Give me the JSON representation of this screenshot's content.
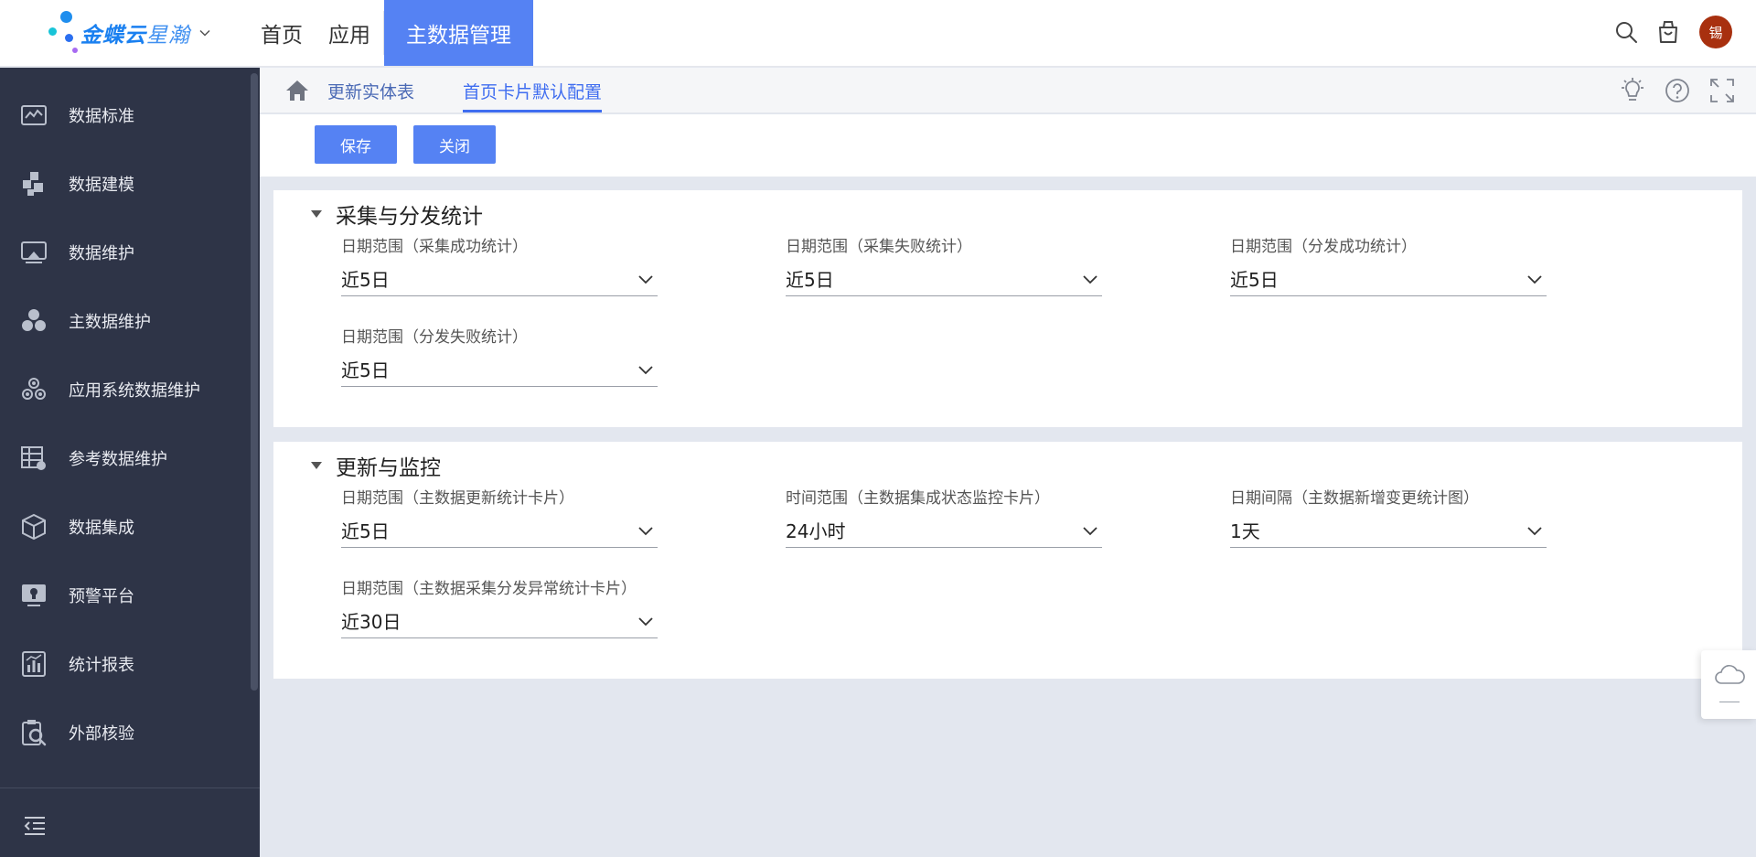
{
  "app": {
    "logo_text": "金蝶云",
    "logo_sub": "星瀚"
  },
  "topnav": {
    "items": [
      {
        "label": "首页"
      },
      {
        "label": "应用"
      },
      {
        "label": "主数据管理"
      }
    ],
    "active_index": 2,
    "avatar_text": "锡"
  },
  "sidebar": {
    "items": [
      {
        "label": "数据标准",
        "icon": "data-standard-icon"
      },
      {
        "label": "数据建模",
        "icon": "data-modeling-icon"
      },
      {
        "label": "数据维护",
        "icon": "data-maintenance-icon"
      },
      {
        "label": "主数据维护",
        "icon": "master-data-icon"
      },
      {
        "label": "应用系统数据维护",
        "icon": "app-system-data-icon"
      },
      {
        "label": "参考数据维护",
        "icon": "reference-data-icon"
      },
      {
        "label": "数据集成",
        "icon": "data-integration-icon"
      },
      {
        "label": "预警平台",
        "icon": "alert-platform-icon"
      },
      {
        "label": "统计报表",
        "icon": "statistics-report-icon"
      },
      {
        "label": "外部核验",
        "icon": "external-verify-icon"
      }
    ]
  },
  "tabs": [
    {
      "label": "更新实体表"
    },
    {
      "label": "首页卡片默认配置"
    }
  ],
  "active_tab": 1,
  "toolbar": {
    "save_label": "保存",
    "close_label": "关闭"
  },
  "sections": [
    {
      "title": "采集与分发统计",
      "fields": [
        {
          "label": "日期范围（采集成功统计）",
          "value": "近5日"
        },
        {
          "label": "日期范围（采集失败统计）",
          "value": "近5日"
        },
        {
          "label": "日期范围（分发成功统计）",
          "value": "近5日"
        },
        {
          "label": "日期范围（分发失败统计）",
          "value": "近5日"
        }
      ]
    },
    {
      "title": "更新与监控",
      "fields": [
        {
          "label": "日期范围（主数据更新统计卡片）",
          "value": "近5日"
        },
        {
          "label": "时间范围（主数据集成状态监控卡片）",
          "value": "24小时"
        },
        {
          "label": "日期间隔（主数据新增变更统计图）",
          "value": "1天"
        },
        {
          "label": "日期范围（主数据采集分发异常统计卡片）",
          "value": "近30日"
        }
      ]
    }
  ],
  "colors": {
    "primary": "#5582f3",
    "sidebar_bg": "#2e3447",
    "tab_active": "#3f6df0",
    "avatar_bg": "#a8300f"
  }
}
